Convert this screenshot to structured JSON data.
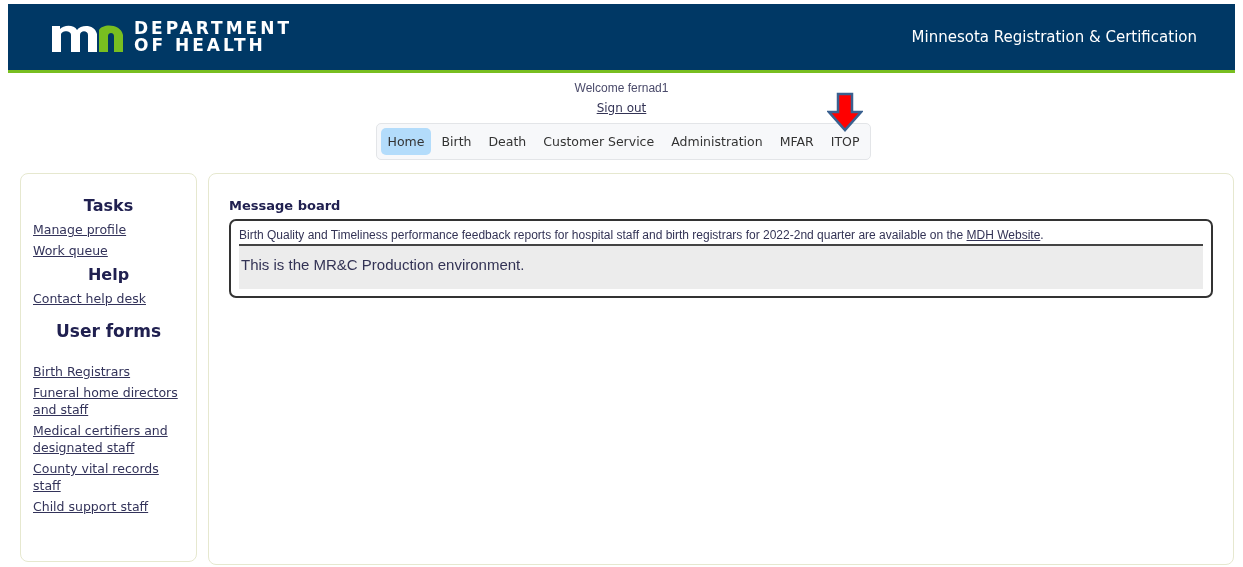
{
  "header": {
    "org_line_1": "DEPARTMENT",
    "org_line_2": "OF HEALTH",
    "app_title": "Minnesota Registration & Certification"
  },
  "user": {
    "welcome": "Welcome fernad1",
    "sign_out": "Sign out"
  },
  "tabs": [
    {
      "label": "Home",
      "selected": true
    },
    {
      "label": "Birth",
      "selected": false
    },
    {
      "label": "Death",
      "selected": false
    },
    {
      "label": "Customer Service",
      "selected": false
    },
    {
      "label": "Administration",
      "selected": false
    },
    {
      "label": "MFAR",
      "selected": false
    },
    {
      "label": "ITOP",
      "selected": false
    }
  ],
  "sidebar": {
    "sections": [
      {
        "title": "Tasks",
        "links": [
          "Manage profile",
          "Work queue"
        ]
      },
      {
        "title": "Help",
        "links": [
          "Contact help desk"
        ]
      },
      {
        "title": "User forms",
        "links": [
          "Birth Registrars",
          "Funeral home directors and staff",
          "Medical certifiers and designated staff",
          "County vital records staff",
          "Child support staff"
        ]
      }
    ]
  },
  "message_board": {
    "title": "Message board",
    "notice_text": "Birth Quality and Timeliness performance feedback reports for hospital staff and birth registrars for 2022-2nd quarter are available on the",
    "notice_link": "MDH Website",
    "notice_end": ".",
    "environment": "This is the MR&C Production environment."
  }
}
